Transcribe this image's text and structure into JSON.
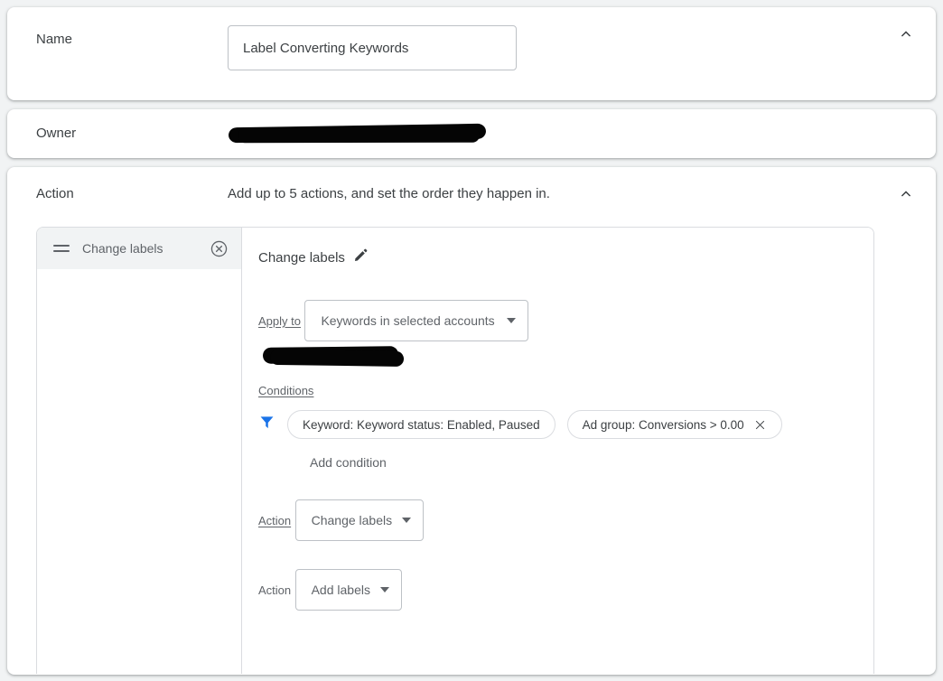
{
  "name_section": {
    "label": "Name",
    "input_value": "Label Converting Keywords",
    "input_placeholder": "Name",
    "collapse_icon": "chevron-up-icon"
  },
  "owner_section": {
    "label": "Owner",
    "value": "",
    "redacted": true
  },
  "action_section": {
    "label": "Action",
    "description": "Add up to 5 actions, and set the order they happen in.",
    "collapse_icon": "chevron-up-icon",
    "action_list": [
      {
        "label": "Change labels",
        "drag_handle_icon": "drag-handle-icon",
        "remove_icon": "close-circle-icon",
        "selected": true
      }
    ],
    "detail": {
      "title": "Change labels",
      "edit_icon": "pencil-icon",
      "apply_to": {
        "label": "Apply to",
        "selected": "Keywords in selected accounts",
        "caret_icon": "chevron-down-icon",
        "account_value_redacted": true
      },
      "conditions": {
        "label": "Conditions",
        "filter_icon": "filter-funnel-icon",
        "chips": [
          {
            "text": "Keyword: Keyword status: Enabled, Paused",
            "removable": false
          },
          {
            "text": "Ad group: Conversions > 0.00",
            "removable": true,
            "remove_icon": "close-icon"
          }
        ],
        "add_condition_label": "Add condition"
      },
      "action_type": {
        "label": "Action",
        "selected": "Change labels",
        "caret_icon": "chevron-down-icon"
      },
      "action_sub": {
        "label": "Action",
        "selected": "Add labels",
        "caret_icon": "chevron-down-icon"
      }
    }
  },
  "colors": {
    "page_background": "#f1f3f4",
    "card_background": "#ffffff",
    "text_primary": "#3c4043",
    "text_secondary": "#5f6368",
    "border": "#dadce0",
    "accent_blue": "#1a73e8",
    "redaction": "#050505"
  }
}
